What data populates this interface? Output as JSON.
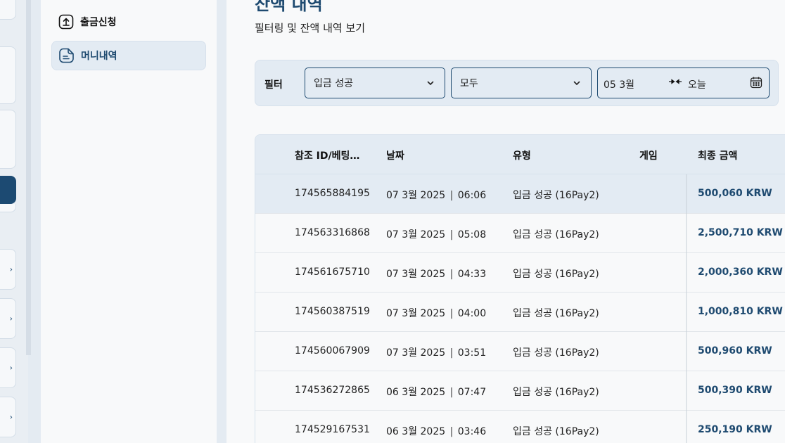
{
  "sidebar": {
    "items": [
      {
        "label": "출금신청",
        "icon": "upload-icon",
        "active": false
      },
      {
        "label": "머니내역",
        "icon": "document-icon",
        "active": true
      }
    ]
  },
  "page": {
    "title": "잔액 내역",
    "subtitle": "필터링 및 잔액 내역 보기"
  },
  "filter": {
    "label": "필터",
    "status_select": "입금 성공",
    "type_select": "모두",
    "date_from": "05 3월",
    "date_to": "오늘"
  },
  "table": {
    "headers": {
      "id": "참조 ID/베팅…",
      "date": "날짜",
      "type": "유형",
      "game": "게임",
      "amount": "최종 금액"
    },
    "rows": [
      {
        "id": "174565884195",
        "day": "07 3월 2025",
        "time": "06:06",
        "type": "입금 성공 (16Pay2)",
        "game": "",
        "amount": "500,060 KRW"
      },
      {
        "id": "174563316868",
        "day": "07 3월 2025",
        "time": "05:08",
        "type": "입금 성공 (16Pay2)",
        "game": "",
        "amount": "2,500,710 KRW"
      },
      {
        "id": "174561675710",
        "day": "07 3월 2025",
        "time": "04:33",
        "type": "입금 성공 (16Pay2)",
        "game": "",
        "amount": "2,000,360 KRW"
      },
      {
        "id": "174560387519",
        "day": "07 3월 2025",
        "time": "04:00",
        "type": "입금 성공 (16Pay2)",
        "game": "",
        "amount": "1,000,810 KRW"
      },
      {
        "id": "174560067909",
        "day": "07 3월 2025",
        "time": "03:51",
        "type": "입금 성공 (16Pay2)",
        "game": "",
        "amount": "500,960 KRW"
      },
      {
        "id": "174536272865",
        "day": "06 3월 2025",
        "time": "07:47",
        "type": "입금 성공 (16Pay2)",
        "game": "",
        "amount": "500,390 KRW"
      },
      {
        "id": "174529167531",
        "day": "06 3월 2025",
        "time": "03:46",
        "type": "입금 성공 (16Pay2)",
        "game": "",
        "amount": "250,190 KRW"
      }
    ]
  },
  "colors": {
    "accent": "#1e4a70",
    "panel": "#e3ebf3",
    "background": "#f8f9fa"
  }
}
